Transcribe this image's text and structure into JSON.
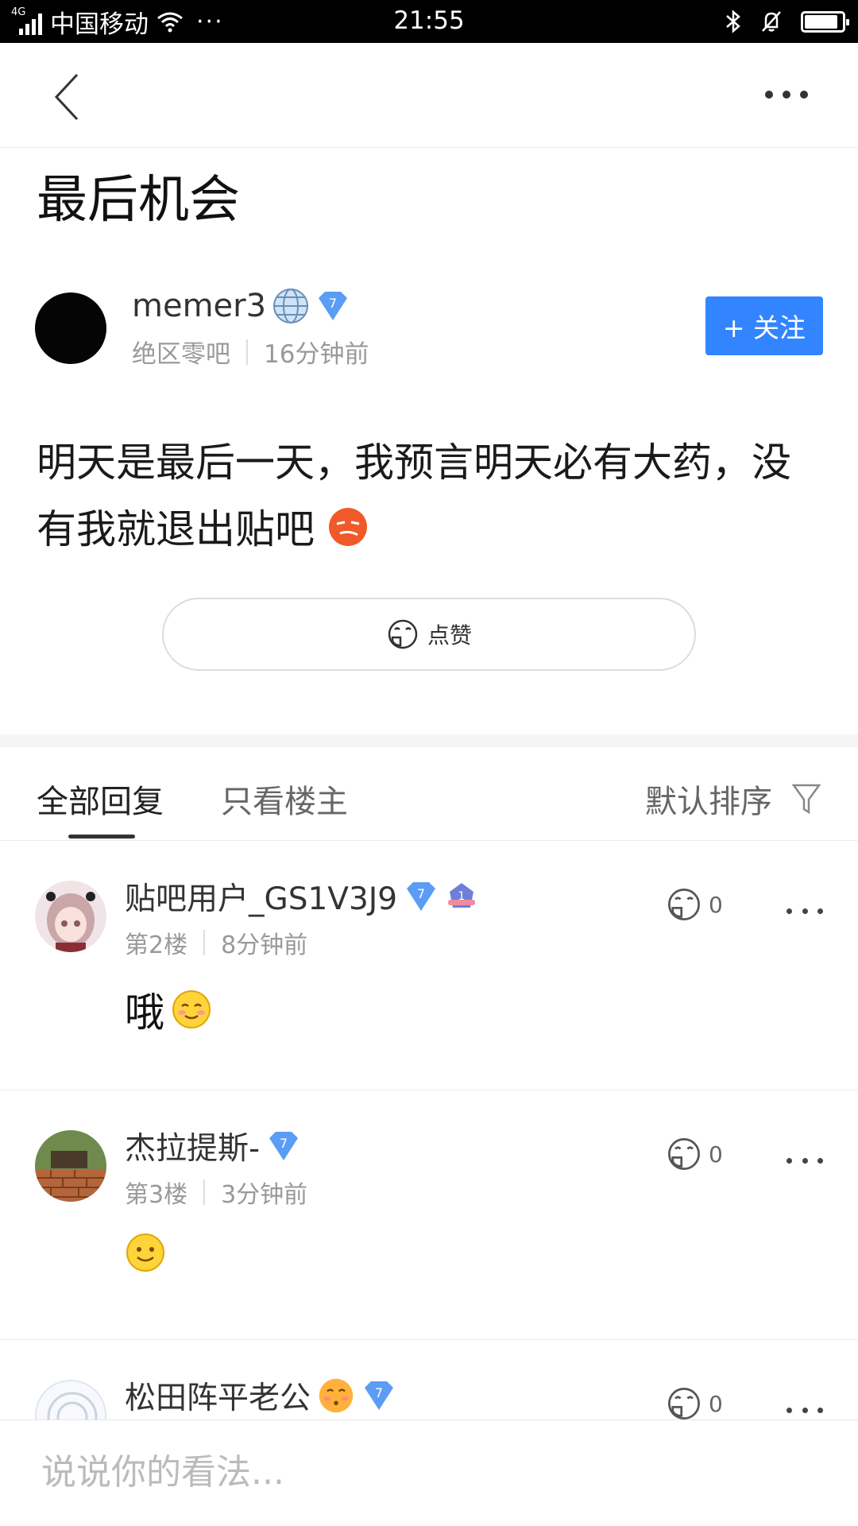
{
  "status_bar": {
    "network": "4G",
    "carrier": "中国移动",
    "extra": "···",
    "time": "21:55",
    "battery_level": 0.9
  },
  "post": {
    "title": "最后机会",
    "author": {
      "name": "memer3",
      "level": "7",
      "forum": "绝区零吧",
      "time": "16分钟前"
    },
    "follow_label": "+ 关注",
    "body": "明天是最后一天，我预言明天必有大药，没有我就退出贴吧",
    "like_label": "点赞"
  },
  "tabs": {
    "all": "全部回复",
    "op_only": "只看楼主",
    "sort": "默认排序"
  },
  "replies": [
    {
      "name": "贴吧用户_GS1V3J9",
      "level": "7",
      "badge": "1",
      "floor": "第2楼",
      "time": "8分钟前",
      "content": "哦",
      "likes": "0"
    },
    {
      "name": "杰拉提斯-",
      "level": "7",
      "floor": "第3楼",
      "time": "3分钟前",
      "content": "",
      "likes": "0"
    },
    {
      "name": "松田阵平老公",
      "level": "7",
      "likes": "0"
    }
  ],
  "comment_bar": {
    "placeholder": "说说你的看法..."
  },
  "colors": {
    "accent": "#3385ff",
    "level_badge": "#5b9cf5",
    "text_secondary": "#999999"
  }
}
